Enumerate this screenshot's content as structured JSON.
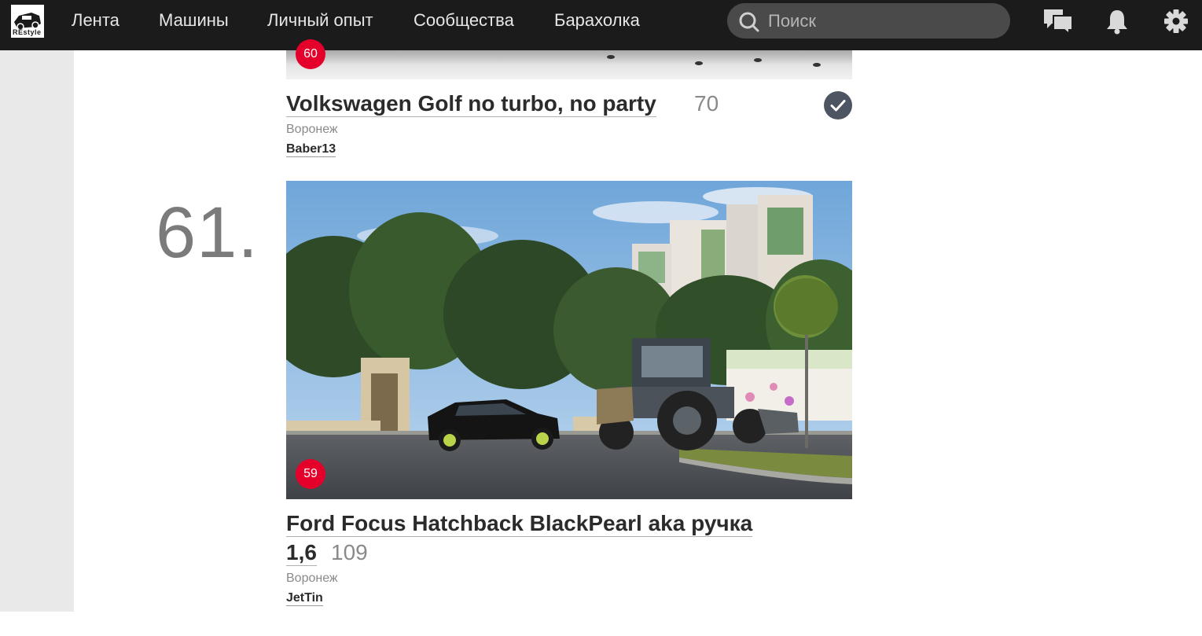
{
  "nav": {
    "logo_text": "REstyle",
    "items": [
      "Лента",
      "Машины",
      "Личный опыт",
      "Сообщества",
      "Барахолка"
    ],
    "search_placeholder": "Поиск",
    "icons": [
      "chat-icon",
      "bell-icon",
      "gear-icon"
    ]
  },
  "entries": [
    {
      "badge": "60",
      "title": "Volkswagen Golf no turbo, no party",
      "count": "70",
      "city": "Воронеж",
      "author": "Baber13",
      "verified": true
    },
    {
      "rank": "61.",
      "badge": "59",
      "title_line1": "Ford Focus Hatchback BlackPearl aka ручка",
      "title_line2": "1,6",
      "count": "109",
      "city": "Воронеж",
      "author": "JetTin"
    }
  ],
  "colors": {
    "topbar": "#1b1b1b",
    "badge": "#e4002b",
    "check": "#4c5561",
    "gutter": "#e9e9e9"
  }
}
